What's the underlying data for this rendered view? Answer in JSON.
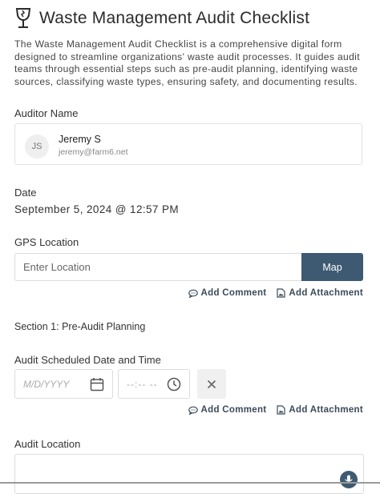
{
  "header": {
    "title": "Waste Management Audit Checklist",
    "description": "The Waste Management Audit Checklist is a comprehensive digital form designed to streamline organizations' waste audit processes. It guides audit teams through essential steps such as pre-audit planning, identifying waste sources, classifying waste types, ensuring safety, and documenting results.",
    "icon": "wine-glass-fragile-icon"
  },
  "auditor": {
    "label": "Auditor Name",
    "initials": "JS",
    "name": "Jeremy S",
    "email": "jeremy@farm6.net"
  },
  "date": {
    "label": "Date",
    "value": "September 5, 2024 @ 12:57 PM"
  },
  "gps": {
    "label": "GPS Location",
    "placeholder": "Enter Location",
    "map_button": "Map"
  },
  "actions": {
    "add_comment": "Add Comment",
    "add_attachment": "Add Attachment"
  },
  "section1": {
    "title": "Section 1: Pre-Audit Planning"
  },
  "schedule": {
    "label": "Audit Scheduled Date and Time",
    "date_placeholder": "M/D/YYYY",
    "time_placeholder": "--:-- --"
  },
  "audit_location": {
    "label": "Audit Location"
  },
  "colors": {
    "accent": "#3d5a72",
    "text": "#333333",
    "border": "#dcdcdc"
  }
}
